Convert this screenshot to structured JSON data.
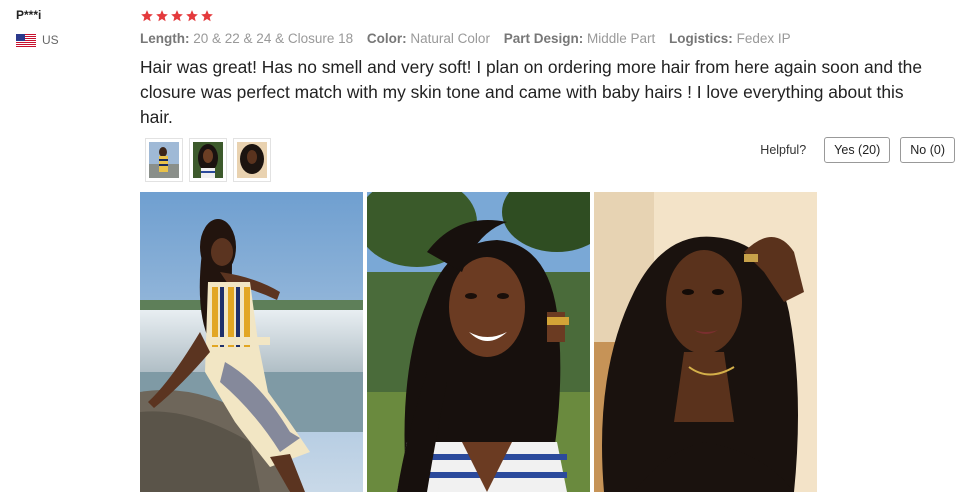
{
  "reviewer": {
    "name": "P***i",
    "country": "US",
    "flag_icon": "us-flag-icon"
  },
  "rating": {
    "stars": 5,
    "max": 5,
    "star_color": "#e4393c"
  },
  "meta": {
    "length_label": "Length:",
    "length_value": "20 & 22 & 24 & Closure 18",
    "color_label": "Color:",
    "color_value": "Natural Color",
    "part_label": "Part Design:",
    "part_value": "Middle Part",
    "logistics_label": "Logistics:",
    "logistics_value": "Fedex IP"
  },
  "review_text": "Hair was great! Has no smell and very soft! I plan on ordering more hair from here again soon and the closure was perfect match with my skin tone and came with baby hairs ! I love everything about this hair.",
  "helpful": {
    "label": "Helpful?",
    "yes_label": "Yes (20)",
    "no_label": "No (0)"
  },
  "thumbnails": [
    "photo-1-thumbnail",
    "photo-2-thumbnail",
    "photo-3-thumbnail"
  ],
  "photos": [
    "customer-photo-waterfall",
    "customer-photo-outdoor",
    "customer-photo-indoor"
  ]
}
